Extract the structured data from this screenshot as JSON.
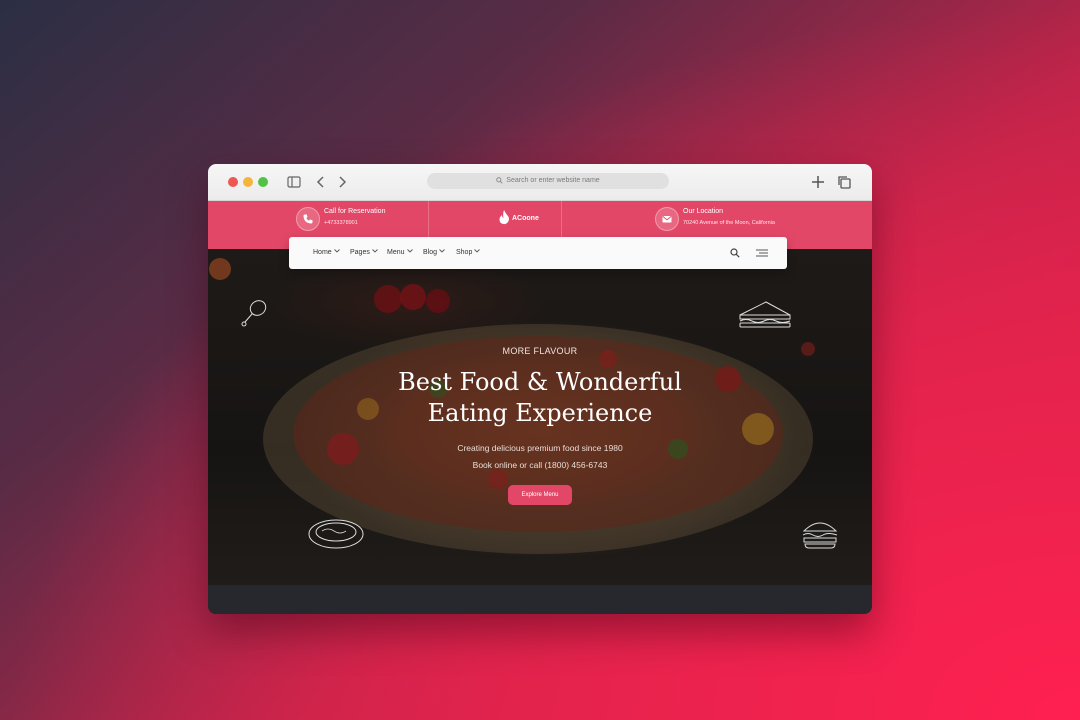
{
  "browser": {
    "url_placeholder": "Search or enter website name"
  },
  "site": {
    "brand": "ACoone",
    "reservation_label": "Call for Reservation",
    "reservation_phone": "+4733378901",
    "location_label": "Our Location",
    "location_address": "70240 Avenue of the Moon, California",
    "accent_color": "#e34767"
  },
  "nav": {
    "items": [
      {
        "label": "Home"
      },
      {
        "label": "Pages"
      },
      {
        "label": "Menu"
      },
      {
        "label": "Blog"
      },
      {
        "label": "Shop"
      }
    ]
  },
  "hero": {
    "eyebrow": "MORE FLAVOUR",
    "headline_line1": "Best Food & Wonderful",
    "headline_line2": "Eating Experience",
    "tagline1": "Creating delicious premium food since 1980",
    "tagline2": "Book online or call (1800) 456-6743",
    "cta": "Explore Menu"
  },
  "icons": [
    "sidebar-toggle-icon",
    "back-icon",
    "forward-icon",
    "search-icon",
    "new-tab-icon",
    "tabs-overview-icon",
    "phone-icon",
    "mail-icon",
    "flame-logo-icon",
    "menu-lines-icon",
    "drumstick-doodle-icon",
    "sandwich-doodle-icon",
    "pie-doodle-icon",
    "burger-doodle-icon"
  ]
}
